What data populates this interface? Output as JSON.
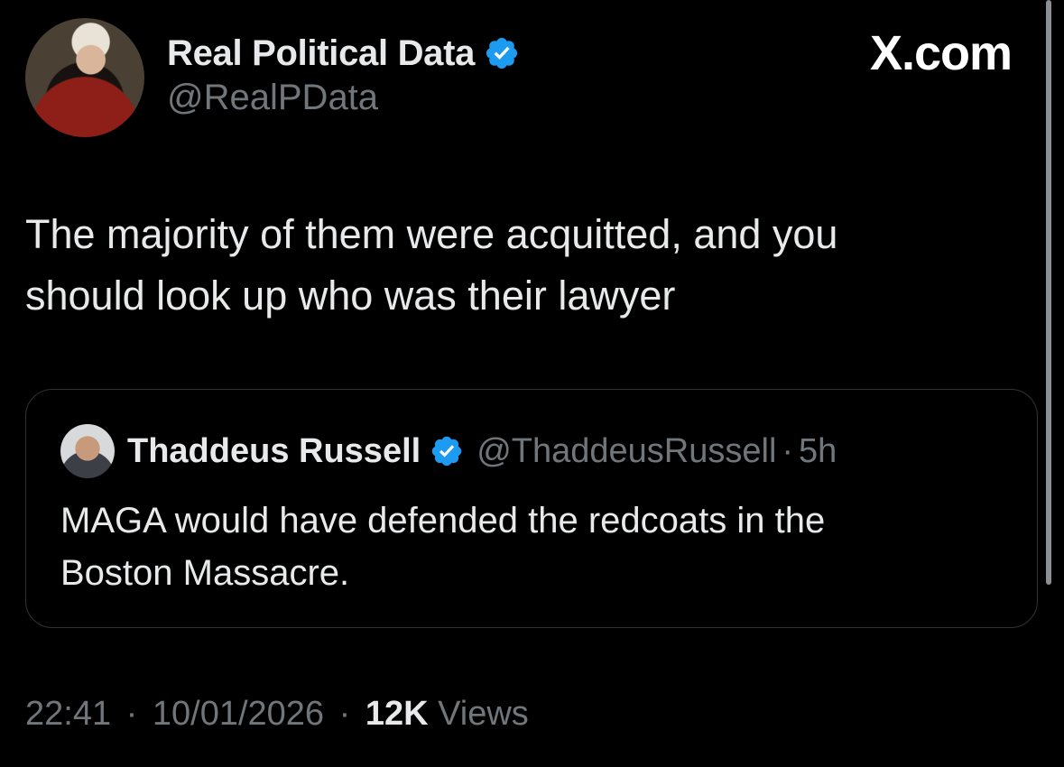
{
  "author": {
    "name": "Real Political Data",
    "handle": "@RealPData",
    "verified": true
  },
  "watermark": "X.com",
  "tweet": {
    "text_lines": [
      "The majority of them were acquitted, and you",
      "should look up who was their lawyer"
    ]
  },
  "quoted_tweet": {
    "name": "Thaddeus Russell",
    "verified": true,
    "handle": "@ThaddeusRussell",
    "separator": "·",
    "age": "5h",
    "text_lines": [
      "MAGA would have defended the redcoats in the",
      "Boston Massacre."
    ]
  },
  "footer": {
    "time": "22:41",
    "separator": "·",
    "date": "10/01/2026",
    "views_count": "12K",
    "views_label": "Views"
  },
  "colors": {
    "background": "#000000",
    "primary_text": "#e7e9ea",
    "secondary_text": "#71767b",
    "verified_badge": "#1d9bf0",
    "card_border": "#2f3336"
  }
}
